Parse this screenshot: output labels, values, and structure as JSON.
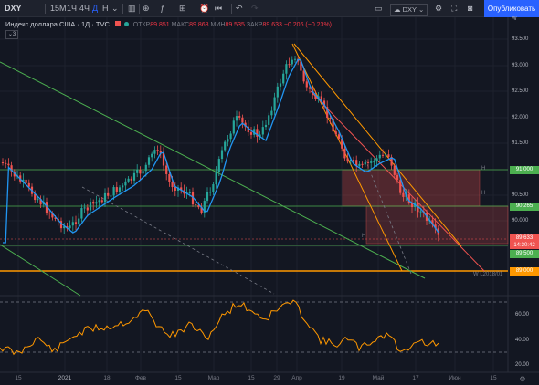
{
  "toolbar": {
    "symbol": "DXY",
    "intervals": [
      "15M",
      "1Ч",
      "4Ч",
      "Д",
      "Н"
    ],
    "active_interval": "Д",
    "compare_symbol": "DXY",
    "publish_label": "Опубликовать"
  },
  "legend": {
    "name": "Индекс доллара США · 1Д · TVC",
    "open_label": "ОТКР",
    "open": "89.851",
    "high_label": "МАКС",
    "high": "89.868",
    "low_label": "МИН",
    "low": "89.535",
    "close_label": "ЗАКР",
    "close": "89.633",
    "change": "−0.206 (−0.23%)",
    "hidden_count": "3"
  },
  "price_axis": {
    "ticks": [
      "93.500",
      "93.000",
      "92.500",
      "92.000",
      "91.500",
      "90.500",
      "90.000"
    ],
    "current_price": "89.633",
    "countdown": "14:30:42",
    "badges": [
      {
        "text": "91.000",
        "color": "#4caf50"
      },
      {
        "text": "90.265",
        "color": "#4caf50"
      },
      {
        "text": "89.500",
        "color": "#4caf50"
      },
      {
        "text": "89.000",
        "color": "#ff9800"
      }
    ],
    "top_label": "W",
    "h_markers": [
      "H",
      "H",
      "H"
    ],
    "note": "W L2018/01"
  },
  "indicator_axis": {
    "ticks": [
      "60.00",
      "40.00",
      "20.00"
    ]
  },
  "time_axis": {
    "ticks": [
      "15",
      "2021",
      "18",
      "Фев",
      "15",
      "Мар",
      "15",
      "29",
      "Апр",
      "19",
      "Май",
      "17",
      "Июн",
      "15"
    ]
  },
  "colors": {
    "bull": "#26a69a",
    "bear": "#ef5350",
    "ma": "#2196f3",
    "trend_green": "#4caf50",
    "trend_orange": "#ff9800",
    "osc": "#ff9800"
  }
}
